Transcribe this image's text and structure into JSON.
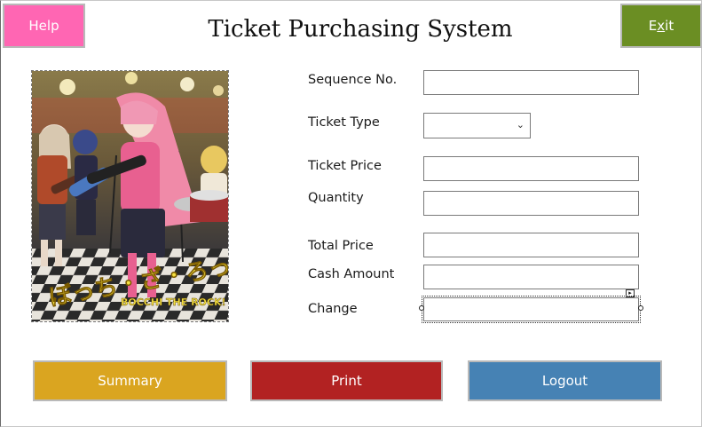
{
  "window": {
    "title": "Ticket Purchasing System"
  },
  "header": {
    "help_label": "Help",
    "exit_label_pre": "E",
    "exit_label_underlined": "x",
    "exit_label_post": "it"
  },
  "poster": {
    "logo_text": "ぼっち・ざ・ろっく!",
    "subtitle": "BOCCHI THE ROCK!"
  },
  "form": {
    "sequence_label": "Sequence No.",
    "sequence_value": "",
    "ticket_type_label": "Ticket Type",
    "ticket_type_value": "",
    "ticket_price_label": "Ticket Price",
    "ticket_price_value": "",
    "quantity_label": "Quantity",
    "quantity_value": "",
    "total_price_label": "Total Price",
    "total_price_value": "",
    "cash_amount_label": "Cash Amount",
    "cash_amount_value": "",
    "change_label": "Change",
    "change_value": ""
  },
  "footer": {
    "summary_label": "Summary",
    "print_label": "Print",
    "logout_label": "Logout"
  },
  "colors": {
    "help": "#ff66b3",
    "exit": "#6b8e23",
    "summary": "#daa520",
    "print": "#b22222",
    "logout": "#4682b4"
  }
}
